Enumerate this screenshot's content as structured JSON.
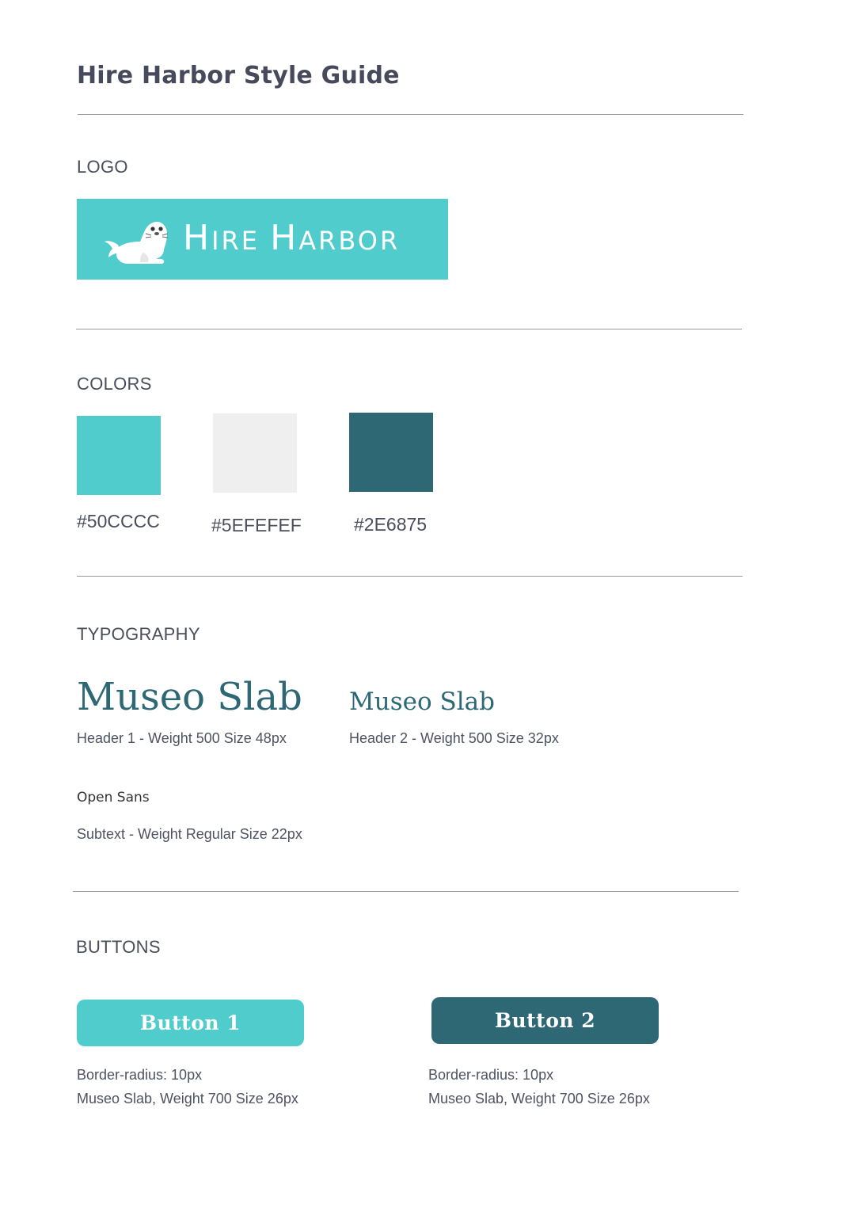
{
  "title": "Hire Harbor Style Guide",
  "sections": {
    "logo": {
      "label": "LOGO"
    },
    "colors": {
      "label": "COLORS"
    },
    "typography": {
      "label": "TYPOGRAPHY"
    },
    "buttons": {
      "label": "BUTTONS"
    }
  },
  "logo": {
    "wordmark_first": "H",
    "wordmark_first_rest": "IRE",
    "wordmark_second": "H",
    "wordmark_second_rest": "ARBOR",
    "background_color": "#50CCCC",
    "icon": "seal-icon"
  },
  "colors": [
    {
      "label": "#50CCCC",
      "hex": "#50CCCC"
    },
    {
      "label": "#5EFEFEF",
      "hex": "#EFEFEF"
    },
    {
      "label": "#2E6875",
      "hex": "#2E6875"
    }
  ],
  "typography": {
    "header1_sample": "Museo Slab",
    "header1_caption": "Header 1 - Weight 500 Size 48px",
    "header2_sample": "Museo Slab",
    "header2_caption": "Header 2  - Weight 500 Size 32px",
    "subtext_font": "Open Sans",
    "subtext_caption": "Subtext - Weight Regular Size 22px"
  },
  "buttons": [
    {
      "label": "Button 1",
      "color": "#50CCCC",
      "spec_line1": "Border-radius: 10px",
      "spec_line2": "Museo Slab, Weight 700 Size 26px"
    },
    {
      "label": "Button 2",
      "color": "#2E6875",
      "spec_line1": "Border-radius: 10px",
      "spec_line2": "Museo Slab, Weight 700 Size 26px"
    }
  ]
}
